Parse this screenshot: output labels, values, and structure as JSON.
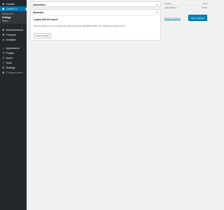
{
  "sidebar": {
    "items_top": [
      {
        "label": "Contact",
        "icon": "contact-icon"
      }
    ],
    "current": {
      "label": "CoreIFC1",
      "icon": "plugin-icon"
    },
    "submenu": [
      {
        "label": "Dashboard",
        "active": false
      },
      {
        "label": "Settings",
        "active": true
      },
      {
        "label": "Status",
        "active": false
      }
    ],
    "items_bottom": [
      {
        "label": "WooCommerce",
        "icon": "woocommerce-icon"
      },
      {
        "label": "Products",
        "icon": "products-icon"
      },
      {
        "label": "Analytics",
        "icon": "analytics-icon"
      }
    ],
    "items_tools": [
      {
        "label": "Appearance",
        "icon": "appearance-icon"
      },
      {
        "label": "Plugins",
        "icon": "plugins-icon"
      },
      {
        "label": "Users",
        "icon": "users-icon"
      },
      {
        "label": "Tools",
        "icon": "tools-icon"
      },
      {
        "label": "Settings",
        "icon": "settings-icon"
      }
    ],
    "collapse_label": "Collapse menu"
  },
  "automation_panel": {
    "title": "Automation"
  },
  "advanced_panel": {
    "title": "Advanced",
    "legacy_title": "Legacy Add-On Import",
    "description": "Use this section to import settings from WooCommerce Hide Billing Fields. You will always override the IF.",
    "import_button": "Import Settings"
  },
  "meta": {
    "rows": [
      {
        "label": "Version",
        "value": "Post"
      },
      {
        "label": "Authorization",
        "value": "Public"
      }
    ],
    "return_link": "Return to options",
    "save_button": "Save changes"
  },
  "colors": {
    "sidebar_bg": "#23282d",
    "accent": "#0073aa",
    "page_bg": "#f1f1f1"
  }
}
